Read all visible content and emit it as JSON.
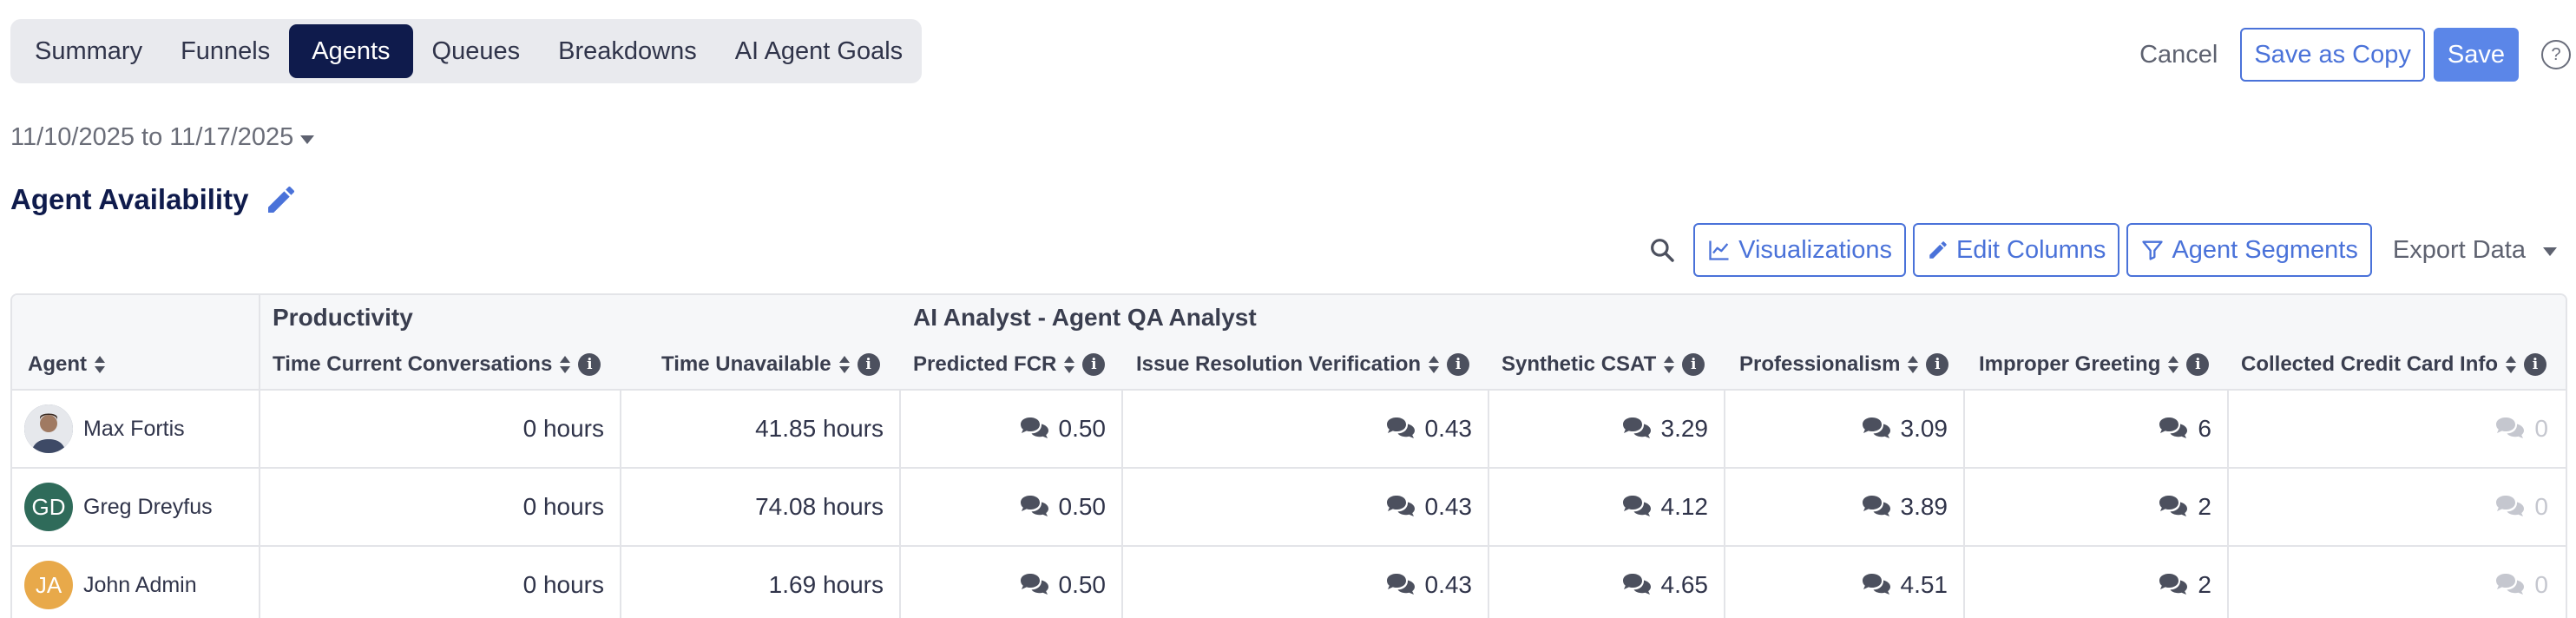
{
  "tabs": [
    {
      "label": "Summary",
      "active": false
    },
    {
      "label": "Funnels",
      "active": false
    },
    {
      "label": "Agents",
      "active": true
    },
    {
      "label": "Queues",
      "active": false
    },
    {
      "label": "Breakdowns",
      "active": false
    },
    {
      "label": "AI Agent Goals",
      "active": false
    }
  ],
  "actions": {
    "cancel": "Cancel",
    "save_copy": "Save as Copy",
    "save": "Save",
    "help": "?"
  },
  "date_range": "11/10/2025 to 11/17/2025",
  "title": "Agent Availability",
  "toolbar": {
    "visualizations": "Visualizations",
    "edit_columns": "Edit Columns",
    "agent_segments": "Agent Segments",
    "export": "Export Data"
  },
  "table": {
    "groups": {
      "productivity": "Productivity",
      "ai": "AI Analyst - Agent QA Analyst"
    },
    "headers": {
      "agent": "Agent",
      "time_current": "Time Current Conversations",
      "time_unavailable": "Time Unavailable",
      "predicted_fcr": "Predicted FCR",
      "issue_resolution": "Issue Resolution Verification",
      "synthetic_csat": "Synthetic CSAT",
      "professionalism": "Professionalism",
      "improper_greeting": "Improper Greeting",
      "credit_card": "Collected Credit Card Info"
    },
    "rows": [
      {
        "name": "Max Fortis",
        "initials": "",
        "avatar_color": "#6c7a8e",
        "time_current": "0 hours",
        "time_unavailable": "41.85 hours",
        "predicted_fcr": "0.50",
        "issue_resolution": "0.43",
        "synthetic_csat": "3.29",
        "professionalism": "3.09",
        "improper_greeting": "6",
        "credit_card": "0"
      },
      {
        "name": "Greg Dreyfus",
        "initials": "GD",
        "avatar_color": "#2f6b5a",
        "time_current": "0 hours",
        "time_unavailable": "74.08 hours",
        "predicted_fcr": "0.50",
        "issue_resolution": "0.43",
        "synthetic_csat": "4.12",
        "professionalism": "3.89",
        "improper_greeting": "2",
        "credit_card": "0"
      },
      {
        "name": "John Admin",
        "initials": "JA",
        "avatar_color": "#e8a94a",
        "time_current": "0 hours",
        "time_unavailable": "1.69 hours",
        "predicted_fcr": "0.50",
        "issue_resolution": "0.43",
        "synthetic_csat": "4.65",
        "professionalism": "4.51",
        "improper_greeting": "2",
        "credit_card": "0"
      }
    ]
  }
}
